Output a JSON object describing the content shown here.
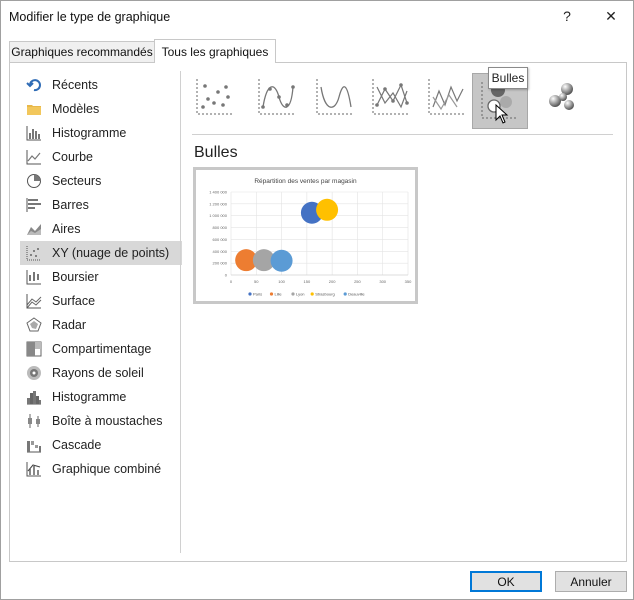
{
  "window": {
    "title": "Modifier le type de graphique",
    "help_glyph": "?",
    "close_glyph": "✕"
  },
  "tabs": [
    {
      "label": "Graphiques recommandés",
      "selected": false
    },
    {
      "label": "Tous les graphiques",
      "selected": true
    }
  ],
  "sidebar": {
    "items": [
      {
        "label": "Récents",
        "icon": "recent-icon"
      },
      {
        "label": "Modèles",
        "icon": "folder-icon"
      },
      {
        "label": "Histogramme",
        "icon": "column-chart-icon"
      },
      {
        "label": "Courbe",
        "icon": "line-chart-icon"
      },
      {
        "label": "Secteurs",
        "icon": "pie-chart-icon"
      },
      {
        "label": "Barres",
        "icon": "bar-chart-icon"
      },
      {
        "label": "Aires",
        "icon": "area-chart-icon"
      },
      {
        "label": "XY (nuage de points)",
        "icon": "scatter-chart-icon",
        "selected": true
      },
      {
        "label": "Boursier",
        "icon": "stock-chart-icon"
      },
      {
        "label": "Surface",
        "icon": "surface-chart-icon"
      },
      {
        "label": "Radar",
        "icon": "radar-chart-icon"
      },
      {
        "label": "Compartimentage",
        "icon": "treemap-chart-icon"
      },
      {
        "label": "Rayons de soleil",
        "icon": "sunburst-chart-icon"
      },
      {
        "label": "Histogramme",
        "icon": "histogram-chart-icon"
      },
      {
        "label": "Boîte à moustaches",
        "icon": "box-whisker-chart-icon"
      },
      {
        "label": "Cascade",
        "icon": "waterfall-chart-icon"
      },
      {
        "label": "Graphique combiné",
        "icon": "combo-chart-icon"
      }
    ]
  },
  "subtypes": [
    {
      "icon": "scatter-markers-icon"
    },
    {
      "icon": "scatter-smooth-markers-icon"
    },
    {
      "icon": "scatter-smooth-lines-icon"
    },
    {
      "icon": "scatter-straight-markers-icon"
    },
    {
      "icon": "scatter-straight-lines-icon"
    },
    {
      "icon": "bubble-icon",
      "selected": true
    },
    {
      "icon": "bubble-3d-icon"
    }
  ],
  "tooltip": "Bulles",
  "section_title": "Bulles",
  "preview": {
    "chart_data": {
      "type": "scatter",
      "title": "Répartition des ventes par magasin",
      "xlim": [
        0,
        350
      ],
      "ylim": [
        0,
        1400000
      ],
      "x_ticks": [
        "0",
        "50",
        "100",
        "150",
        "200",
        "250",
        "300",
        "350"
      ],
      "y_ticks": [
        "0",
        "200 000",
        "400 000",
        "600 000",
        "800 000",
        "1 000 000",
        "1 200 000",
        "1 400 000"
      ],
      "grid": true,
      "legend_position": "bottom",
      "series": [
        {
          "name": "Paris",
          "x": 160,
          "y": 1050000,
          "color": "#4472c4"
        },
        {
          "name": "Lille",
          "x": 30,
          "y": 250000,
          "color": "#ed7d31"
        },
        {
          "name": "Lyon",
          "x": 65,
          "y": 250000,
          "color": "#a5a5a5"
        },
        {
          "name": "Strasbourg",
          "x": 190,
          "y": 1100000,
          "color": "#ffc000"
        },
        {
          "name": "Deauville",
          "x": 100,
          "y": 240000,
          "color": "#5b9bd5"
        }
      ]
    }
  },
  "buttons": {
    "ok": "OK",
    "cancel": "Annuler"
  }
}
